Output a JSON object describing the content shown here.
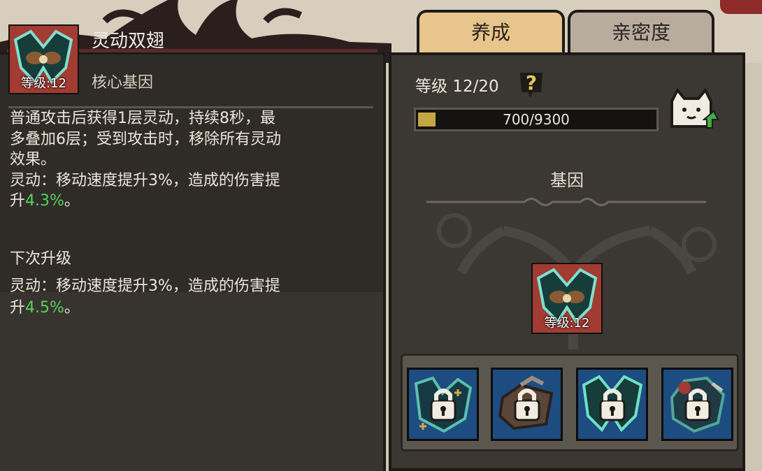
{
  "tabs": [
    {
      "label": "养成",
      "active": true
    },
    {
      "label": "亲密度",
      "active": false
    }
  ],
  "skill": {
    "name": "灵动双翅",
    "type": "核心基因",
    "level_label": "等级:12",
    "icon": "wing-gene-icon",
    "description_line1": "普通攻击后获得1层灵动，持续8秒，最",
    "description_line2": "多叠加6层；受到攻击时，移除所有灵动",
    "description_line3": "效果。",
    "effect_line1": "灵动：移动速度提升3%，造成的伤害提",
    "effect_line2_prefix": "升",
    "effect_current_value": "4.3%",
    "effect_suffix": "。"
  },
  "next_upgrade": {
    "title": "下次升级",
    "effect_line1": "灵动：移动速度提升3%，造成的伤害提",
    "effect_line2_prefix": "升",
    "effect_next_value": "4.5%",
    "effect_suffix": "。"
  },
  "cultivation": {
    "level_text": "等级 12/20",
    "exp_text": "700/9300",
    "exp_fraction": 0.075,
    "help_icon": "question-icon",
    "pet_icon": "cat-upgrade-icon",
    "gene_section_label": "基因",
    "center_gene_level": "等级:12",
    "slots": [
      {
        "icon": "locked-gene-slot-1",
        "locked": true
      },
      {
        "icon": "locked-gene-slot-2",
        "locked": true
      },
      {
        "icon": "locked-gene-slot-3",
        "locked": true
      },
      {
        "icon": "locked-gene-slot-4",
        "locked": true
      }
    ]
  },
  "colors": {
    "accent_green": "#54d35a",
    "tab_active": "#e7c58c",
    "exp_fill": "#c6a544",
    "slot_bg": "#1d4c80"
  }
}
